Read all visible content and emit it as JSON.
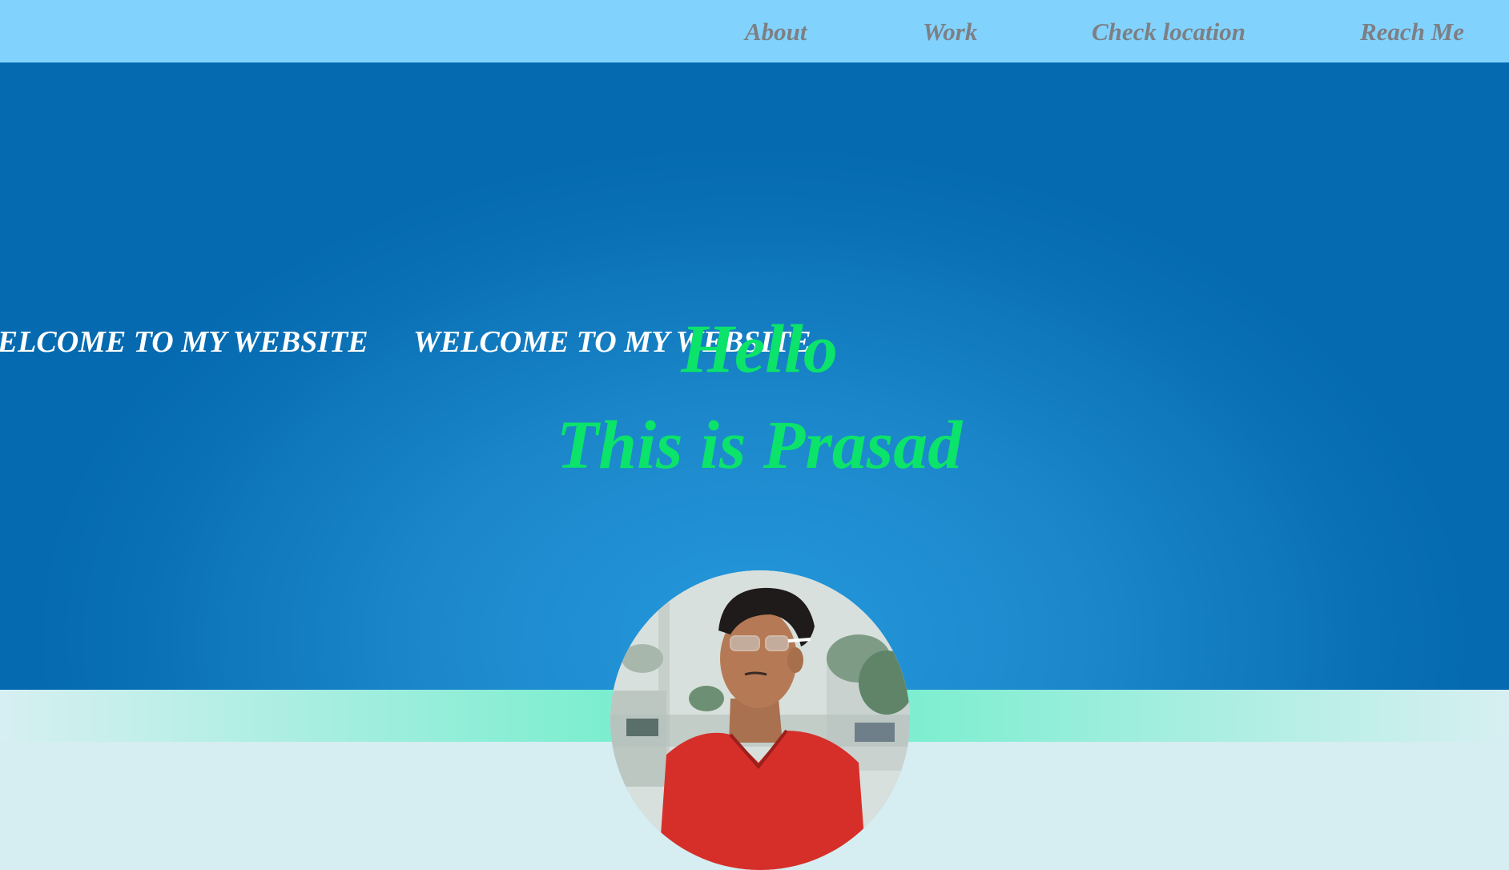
{
  "nav": {
    "items": [
      {
        "label": "About"
      },
      {
        "label": "Work"
      },
      {
        "label": "Check location"
      },
      {
        "label": "Reach Me"
      }
    ]
  },
  "hero": {
    "marquee": [
      "WELCOME TO MY WEBSITE",
      "WELCOME TO MY WEBSITE"
    ],
    "greeting": "Hello",
    "intro": "This is Prasad"
  },
  "colors": {
    "navbar": "#81d3fe",
    "nav_text": "#7d7f84",
    "hero_bg": "#1c88cb",
    "greeting": "#0be36a",
    "marquee": "#ffffff"
  }
}
